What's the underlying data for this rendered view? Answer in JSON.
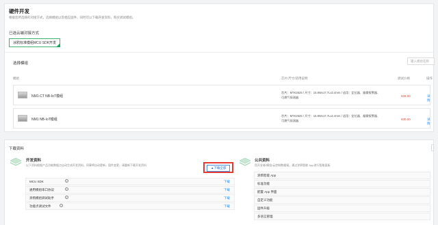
{
  "header": {
    "title": "硬件开发",
    "subtitle": "根据您所选择的对接方式，选择模组以及相应固件，同时可以下载开发资料，购买调试模组。"
  },
  "connection": {
    "label": "已选云端对接方式",
    "selected": "涂鸦标准模组MCU SDK开发"
  },
  "module_select": {
    "label": "选择模组",
    "search_placeholder": "输入模组名称",
    "columns": [
      "模组",
      "芯片/尺寸/适用说明",
      "调试价格",
      "操作"
    ],
    "rows": [
      {
        "name": "NM1-CT NB-IoT模组",
        "spec_line1": "芯片：MTK2625 / 尺寸：15.8Wx17.7Lx2.4mm / 适用：定位器、烟雾报警器、",
        "spec_line2": "可燃气探测器",
        "price": "¥28.00",
        "action": "详情"
      },
      {
        "name": "NM1 NB-IoT模组",
        "spec_line1": "芯片：MTK2625 / 尺寸：15.8Wx17.7Lx2.4mm / 适用：定位器、烟雾报警器、",
        "spec_line2": "可燃气探测器",
        "price": "¥30.00",
        "action": "详情"
      }
    ]
  },
  "downloads": {
    "title": "下载资料",
    "dev": {
      "title": "开发资料",
      "desc": "以下资料根据产品功能数据点自动生成开发资料，同事将自动更新，固件变更，请重新下载开发资料",
      "download_all": "下载全部",
      "items": [
        {
          "label": "MCU SDK",
          "action": "下载"
        },
        {
          "label": "通用模组串口协议",
          "action": "下载"
        },
        {
          "label": "涂鸦模组调试助手",
          "action": "下载"
        },
        {
          "label": "功能点调试文件",
          "action": "下载"
        }
      ]
    },
    "public": {
      "title": "公共资料",
      "desc": "用开发者/模组/云控制数据接，通过涂鸦智能 App进行智能面板",
      "items": [
        "涂鸦智能 App",
        "标准功能",
        "配置 App 界面",
        "自定义功能",
        "固件升级",
        "多语言管理"
      ]
    }
  }
}
